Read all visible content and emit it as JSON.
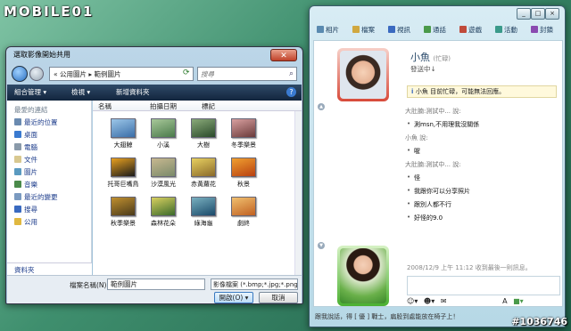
{
  "watermark": {
    "logo_text": "MOBILE01",
    "tag": "#1036746"
  },
  "dialog": {
    "title": "選取影像開始共用",
    "close_icon": "close-icon",
    "address": "«  公用圖片 ▸ 範例圖片",
    "search_placeholder": "搜尋",
    "toolbar": {
      "organize": "組合管理 ▾",
      "view": "檢視 ▾",
      "new_folder": "新增資料夾",
      "help": "?"
    },
    "sidebar": {
      "header": "最愛的連結",
      "items": [
        "最近的位置",
        "桌面",
        "電腦",
        "文件",
        "圖片",
        "音樂",
        "最近的變更",
        "搜尋",
        "公用"
      ],
      "folders": "資料夾"
    },
    "columns": [
      "名稱",
      "拍攝日期",
      "標記"
    ],
    "thumbnails": [
      {
        "label": "大翅鯨",
        "colors": [
          "#3a6ea8",
          "#9cc6e8"
        ]
      },
      {
        "label": "小溪",
        "colors": [
          "#4a7a4a",
          "#a8c89a"
        ]
      },
      {
        "label": "大樹",
        "colors": [
          "#2a4a2a",
          "#8aaa7a"
        ]
      },
      {
        "label": "冬季樂景",
        "colors": [
          "#6a3a3a",
          "#d8a0a0"
        ]
      },
      {
        "label": "托哥巨嘴鳥",
        "colors": [
          "#1a1a1a",
          "#e8a020"
        ]
      },
      {
        "label": "沙漠風光",
        "colors": [
          "#7a8a6a",
          "#c8b890"
        ]
      },
      {
        "label": "赤黃蘿花",
        "colors": [
          "#8a6a2a",
          "#e8d060"
        ]
      },
      {
        "label": "秋景",
        "colors": [
          "#b84010",
          "#f0a030"
        ]
      },
      {
        "label": "秋季樂景",
        "colors": [
          "#4a3a1a",
          "#c09030"
        ]
      },
      {
        "label": "森林花朵",
        "colors": [
          "#3a6a2a",
          "#d8d060"
        ]
      },
      {
        "label": "綠海龜",
        "colors": [
          "#1a4a6a",
          "#7ab0c0"
        ]
      },
      {
        "label": "劇終",
        "colors": [
          "#c06020",
          "#f0c070"
        ]
      }
    ],
    "filename_label": "檔案名稱(N):",
    "filename_value": "範例圖片",
    "filetype": "影像檔案 (*.bmp;*.jpg;*.png",
    "open_label": "開啟(O) ▾",
    "cancel_label": "取消"
  },
  "msn": {
    "toolbar": [
      "相片",
      "檔案",
      "視訊",
      "通話",
      "遊戲",
      "活動",
      "封鎖"
    ],
    "contact_name": "小魚",
    "contact_status_tag": "(忙碌)",
    "contact_sub": "發送中↓",
    "notice": "小魚 目前忙碌，可能無法回應。",
    "chat": [
      {
        "type": "who",
        "text": "大肚腩:測試中... 說:"
      },
      {
        "type": "msg",
        "text": "測msn,不用理我沒關係"
      },
      {
        "type": "who",
        "text": "小魚 說:"
      },
      {
        "type": "msg",
        "text": "喔"
      },
      {
        "type": "who",
        "text": "大肚腩:測試中... 說:"
      },
      {
        "type": "msg",
        "text": "怪"
      },
      {
        "type": "msg",
        "text": "我跟你可以分享照片"
      },
      {
        "type": "msg",
        "text": "跟別人都不行"
      },
      {
        "type": "msg",
        "text": "好怪的9.0"
      }
    ],
    "last_received": "2008/12/9 上午 11:12 收到最後一則訊息。",
    "footer_ad": "跟我說話，得 [ 優 ] 戰士，扁股到處能放在椅子上！",
    "window_controls": [
      "_",
      "□",
      "×"
    ]
  }
}
